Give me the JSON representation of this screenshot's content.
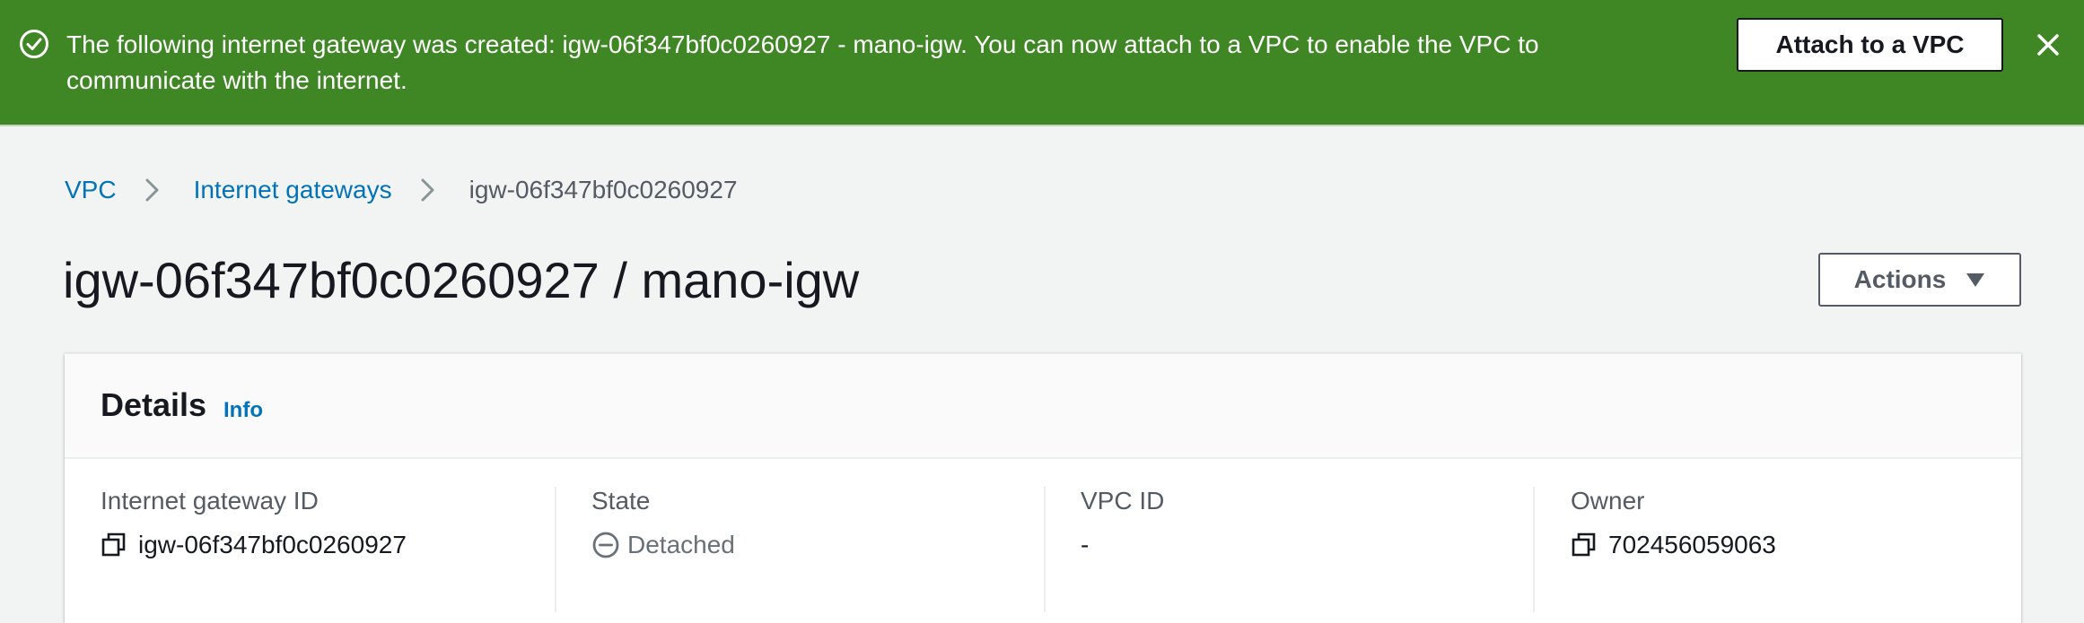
{
  "flash": {
    "message": "The following internet gateway was created: igw-06f347bf0c0260927 - mano-igw. You can now attach to a VPC to enable the VPC to communicate with the internet.",
    "action_label": "Attach to a VPC",
    "status_icon": "check-circle-icon",
    "close_icon": "close-icon",
    "background_color": "#3f8624"
  },
  "breadcrumb": {
    "items": [
      {
        "label": "VPC"
      },
      {
        "label": "Internet gateways"
      }
    ],
    "current": "igw-06f347bf0c0260927"
  },
  "page": {
    "title": "igw-06f347bf0c0260927 / mano-igw",
    "actions_label": "Actions"
  },
  "details": {
    "title": "Details",
    "info_label": "Info",
    "fields": [
      {
        "label": "Internet gateway ID",
        "value": "igw-06f347bf0c0260927",
        "icon": "copy-icon"
      },
      {
        "label": "State",
        "value": "Detached",
        "icon": "minus-circle-icon"
      },
      {
        "label": "VPC ID",
        "value": "-"
      },
      {
        "label": "Owner",
        "value": "702456059063",
        "icon": "copy-icon"
      }
    ]
  },
  "colors": {
    "link": "#0073bb",
    "text": "#16191f",
    "muted": "#545b64"
  }
}
